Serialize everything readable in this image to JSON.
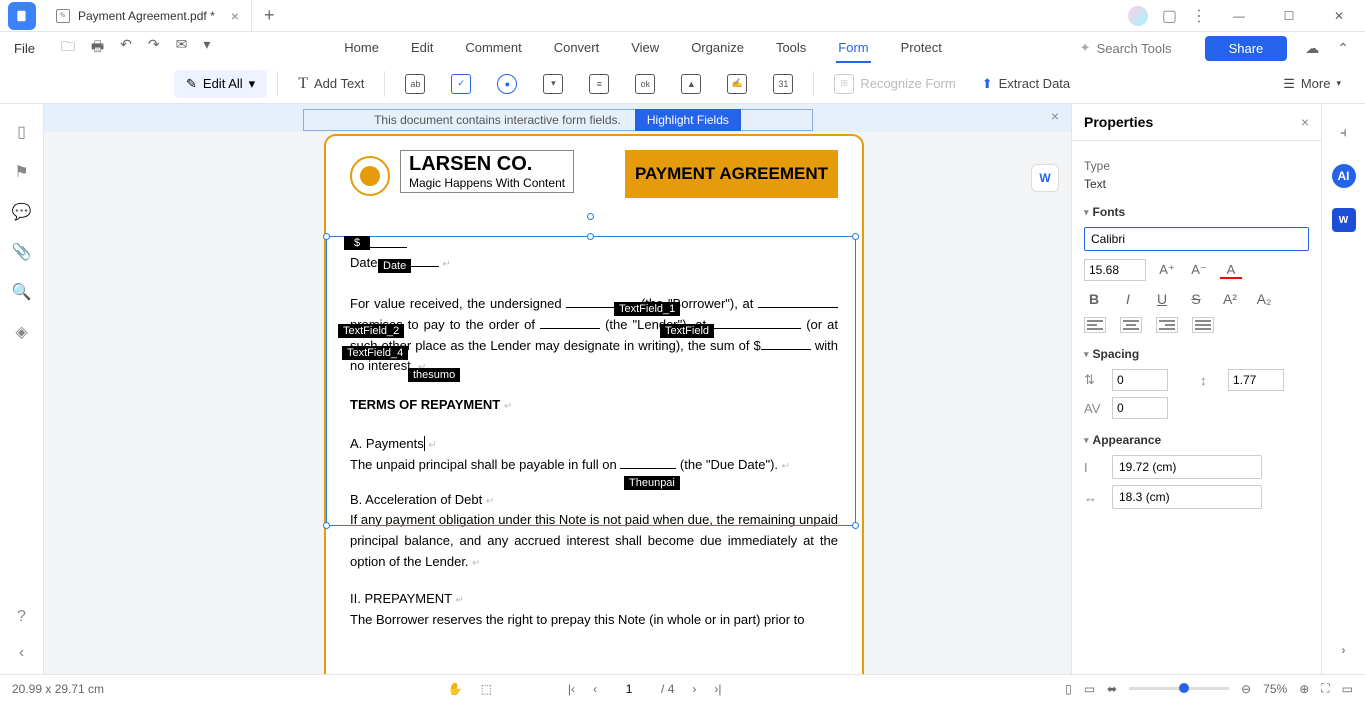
{
  "titlebar": {
    "filename": "Payment Agreement.pdf *"
  },
  "menubar": {
    "file": "File",
    "tabs": {
      "home": "Home",
      "edit": "Edit",
      "comment": "Comment",
      "convert": "Convert",
      "view": "View",
      "organize": "Organize",
      "tools": "Tools",
      "form": "Form",
      "protect": "Protect"
    },
    "search_placeholder": "Search Tools",
    "share": "Share"
  },
  "ribbon": {
    "edit_all": "Edit All",
    "add_text": "Add Text",
    "recognize": "Recognize Form",
    "extract": "Extract Data",
    "more": "More"
  },
  "banner": {
    "text": "This document contains interactive form fields.",
    "highlight": "Highlight Fields"
  },
  "doc": {
    "company": "LARSEN CO.",
    "tagline": "Magic Happens With Content",
    "title": "PAYMENT AGREEMENT",
    "dollar": "$",
    "date_lbl": "Date:",
    "fields": {
      "date": "Date",
      "tf1": "TextField_1",
      "tf2": "TextField_2",
      "tf": "TextField",
      "tf4": "TextField_4",
      "sum": "thesumo",
      "due": "Theunpai"
    },
    "p1a": "For value received, the undersigned ",
    "p1b": " (the \"Borrower\"), at ",
    "p1c": " promises to pay to the order of ",
    "p1d": " (the \"Lender\"), at ",
    "p1e": " (or at such other place as the Lender may designate in writing), the sum of $",
    "p1f": " with no interest.",
    "terms": "TERMS OF REPAYMENT",
    "secA": "A. Payments",
    "pA": "The unpaid principal shall be payable in full on ",
    "pAend": " (the \"Due Date\").",
    "secB": "B. Acceleration of Debt",
    "pB": "If any payment obligation under this Note is not paid when due, the remaining unpaid principal balance, and any accrued interest shall become due immediately at the option of the Lender.",
    "sec2": "II. PREPAYMENT",
    "p2": "The Borrower reserves the right to prepay this Note (in whole or in part) prior to"
  },
  "props": {
    "title": "Properties",
    "type_lbl": "Type",
    "type_val": "Text",
    "fonts_lbl": "Fonts",
    "font_family": "Calibri",
    "font_size": "15.68",
    "spacing_lbl": "Spacing",
    "line_before": "0",
    "line_height": "1.77",
    "char_spacing": "0",
    "appearance_lbl": "Appearance",
    "width": "19.72 (cm)",
    "height": "18.3 (cm)"
  },
  "status": {
    "dims": "20.99 x 29.71 cm",
    "page": "1",
    "page_total": "/ 4",
    "zoom": "75%"
  }
}
